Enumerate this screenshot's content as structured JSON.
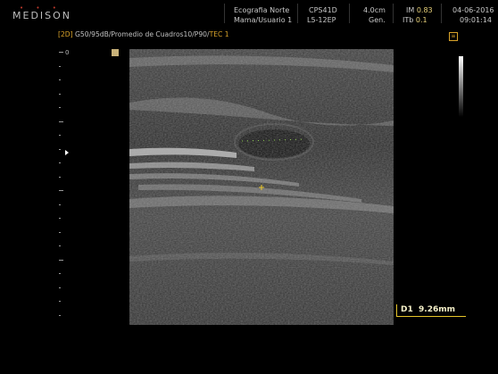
{
  "header": {
    "logo_dots": "• • •",
    "logo": "MEDISON",
    "hospital": "Ecografia Norte",
    "patient": "Mama/Usuario 1",
    "probe": "CPS41D",
    "preset": "L5-12EP",
    "depth": "4.0cm",
    "depth_sub": "Gen.",
    "mi_label": "IM",
    "mi_value": "0.83",
    "itb_label": "ITb",
    "itb_value": "0.1",
    "date": "04-06-2016",
    "time": "09:01:14"
  },
  "params": {
    "mode": "[2D]",
    "settings": "G50/95dB/Promedio de Cuadros10/P90/",
    "tec": "TEC 1"
  },
  "ruler": {
    "zero_label": "0"
  },
  "measurement": {
    "label": "D1",
    "value": "9.26mm"
  },
  "colors": {
    "accent": "#d9a32a",
    "caliper": "#8fd14f",
    "measure_border": "#e8c62a"
  }
}
